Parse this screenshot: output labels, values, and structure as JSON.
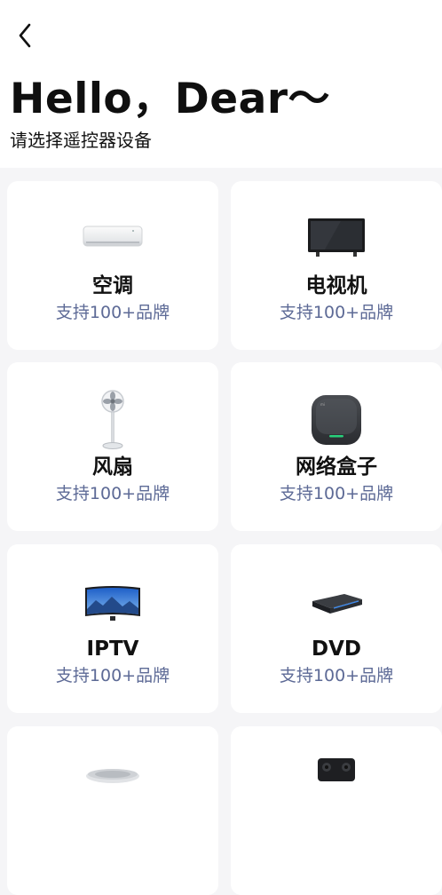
{
  "header": {
    "back_icon": "chevron-left-icon",
    "title": "Hello，Dear～",
    "subtitle": "请选择遥控器设备"
  },
  "devices": [
    {
      "name": "空调",
      "brands": "支持100+品牌",
      "icon": "air-conditioner-icon"
    },
    {
      "name": "电视机",
      "brands": "支持100+品牌",
      "icon": "television-icon"
    },
    {
      "name": "风扇",
      "brands": "支持100+品牌",
      "icon": "fan-icon"
    },
    {
      "name": "网络盒子",
      "brands": "支持100+品牌",
      "icon": "network-box-icon"
    },
    {
      "name": "IPTV",
      "brands": "支持100+品牌",
      "icon": "iptv-icon"
    },
    {
      "name": "DVD",
      "brands": "支持100+品牌",
      "icon": "dvd-player-icon"
    },
    {
      "icon": "air-purifier-icon"
    },
    {
      "icon": "speaker-icon"
    }
  ],
  "colors": {
    "background": "#f5f5f7",
    "card": "#ffffff",
    "brand_text": "#5d6a96",
    "title_text": "#111111"
  }
}
